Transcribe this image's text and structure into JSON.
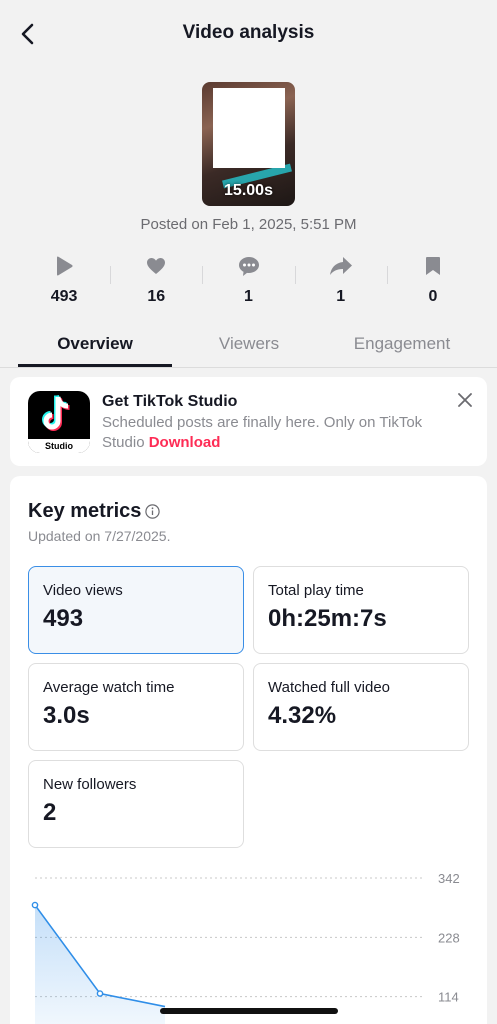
{
  "header": {
    "title": "Video analysis"
  },
  "video": {
    "duration": "15.00s",
    "posted": "Posted on Feb 1, 2025, 5:51 PM"
  },
  "stats": [
    {
      "icon": "play-icon",
      "value": "493"
    },
    {
      "icon": "heart-icon",
      "value": "16"
    },
    {
      "icon": "comment-icon",
      "value": "1"
    },
    {
      "icon": "share-icon",
      "value": "1"
    },
    {
      "icon": "bookmark-icon",
      "value": "0"
    }
  ],
  "tabs": [
    {
      "label": "Overview",
      "active": true
    },
    {
      "label": "Viewers",
      "active": false
    },
    {
      "label": "Engagement",
      "active": false
    }
  ],
  "promo": {
    "app_label": "Studio",
    "title": "Get TikTok Studio",
    "description": "Scheduled posts are finally here. Only on TikTok Studio",
    "link": "Download"
  },
  "metrics": {
    "title": "Key metrics",
    "updated": "Updated on 7/27/2025.",
    "cards": [
      {
        "label": "Video views",
        "value": "493",
        "selected": true
      },
      {
        "label": "Total play time",
        "value": "0h:25m:7s",
        "selected": false
      },
      {
        "label": "Average watch time",
        "value": "3.0s",
        "selected": false
      },
      {
        "label": "Watched full video",
        "value": "4.32%",
        "selected": false
      },
      {
        "label": "New followers",
        "value": "2",
        "selected": false
      }
    ]
  },
  "chart_data": {
    "type": "area",
    "y_ticks": [
      "342",
      "228",
      "114"
    ],
    "ylim": [
      0,
      342
    ],
    "values": [
      290,
      120,
      95
    ],
    "color": "#2f8ee8"
  }
}
